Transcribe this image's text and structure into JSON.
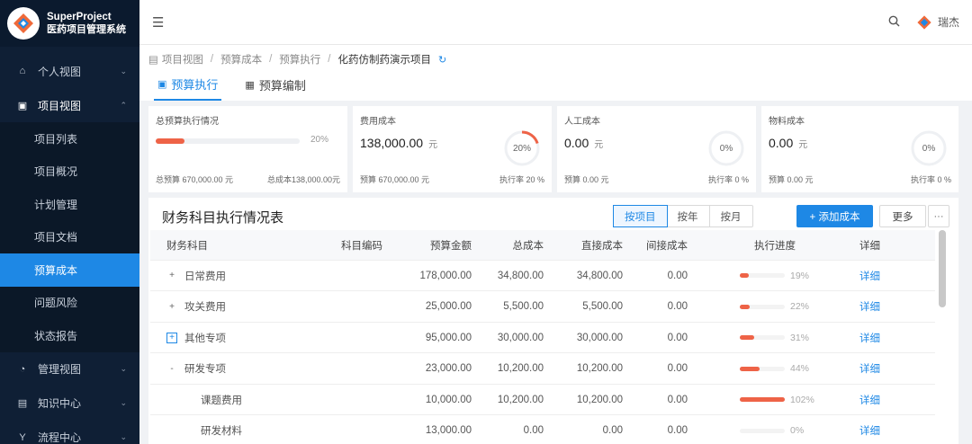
{
  "app": {
    "name_line1": "SuperProject",
    "name_line2": "医药项目管理系统"
  },
  "sidebar": {
    "groups": [
      {
        "label": "个人视图",
        "icon": "home-icon"
      },
      {
        "label": "项目视图",
        "icon": "project-icon"
      }
    ],
    "sub_items": [
      {
        "label": "项目列表"
      },
      {
        "label": "项目概况"
      },
      {
        "label": "计划管理"
      },
      {
        "label": "项目文档"
      },
      {
        "label": "预算成本"
      },
      {
        "label": "问题风险"
      },
      {
        "label": "状态报告"
      }
    ],
    "bottom_groups": [
      {
        "label": "管理视图",
        "icon": "dashboard-icon"
      },
      {
        "label": "知识中心",
        "icon": "book-icon"
      },
      {
        "label": "流程中心",
        "icon": "flow-icon"
      }
    ]
  },
  "topbar": {
    "user": "瑞杰"
  },
  "breadcrumb": {
    "b1": "项目视图",
    "b2": "预算成本",
    "b3": "预算执行",
    "b4": "化药仿制药演示项目"
  },
  "tabs": {
    "t1": "预算执行",
    "t2": "预算编制"
  },
  "cards": {
    "overall": {
      "title": "总预算执行情况",
      "percent": 20,
      "percent_text": "20%",
      "budget": "总预算 670,000.00 元",
      "cost": "总成本138,000.00元"
    },
    "fee": {
      "title": "费用成本",
      "amount": "138,000.00",
      "unit": "元",
      "ring_text": "20%",
      "ring_value": 20,
      "budget": "预算 670,000.00 元",
      "rate": "执行率 20 %"
    },
    "labor": {
      "title": "人工成本",
      "amount": "0.00",
      "unit": "元",
      "ring_text": "0%",
      "ring_value": 0,
      "budget": "预算 0.00 元",
      "rate": "执行率 0 %"
    },
    "material": {
      "title": "物料成本",
      "amount": "0.00",
      "unit": "元",
      "ring_text": "0%",
      "ring_value": 0,
      "budget": "预算 0.00 元",
      "rate": "执行率 0 %"
    }
  },
  "table": {
    "title": "财务科目执行情况表",
    "seg": {
      "s1": "按项目",
      "s2": "按年",
      "s3": "按月"
    },
    "add_label": "+ 添加成本",
    "more_label": "更多",
    "dots_label": "···",
    "headers": {
      "name": "财务科目",
      "code": "科目编码",
      "budget": "预算金额",
      "total": "总成本",
      "direct": "直接成本",
      "indirect": "间接成本",
      "progress": "执行进度",
      "detail": "详细"
    },
    "rows": [
      {
        "expander": "+",
        "name": "日常费用",
        "budget": "178,000.00",
        "total": "34,800.00",
        "direct": "34,800.00",
        "indirect": "0.00",
        "progress": 19,
        "progress_text": "19%",
        "detail": "详细"
      },
      {
        "expander": "+",
        "name": "攻关费用",
        "budget": "25,000.00",
        "total": "5,500.00",
        "direct": "5,500.00",
        "indirect": "0.00",
        "progress": 22,
        "progress_text": "22%",
        "detail": "详细"
      },
      {
        "expander": "+",
        "name": "其他专项",
        "budget": "95,000.00",
        "total": "30,000.00",
        "direct": "30,000.00",
        "indirect": "0.00",
        "progress": 31,
        "progress_text": "31%",
        "detail": "详细"
      },
      {
        "expander": "-",
        "name": "研发专项",
        "budget": "23,000.00",
        "total": "10,200.00",
        "direct": "10,200.00",
        "indirect": "0.00",
        "progress": 44,
        "progress_text": "44%",
        "detail": "详细"
      },
      {
        "expander": "",
        "name": "课题费用",
        "budget": "10,000.00",
        "total": "10,200.00",
        "direct": "10,200.00",
        "indirect": "0.00",
        "progress": 102,
        "progress_text": "102%",
        "detail": "详细"
      },
      {
        "expander": "",
        "name": "研发材料",
        "budget": "13,000.00",
        "total": "0.00",
        "direct": "0.00",
        "indirect": "0.00",
        "progress": 0,
        "progress_text": "0%",
        "detail": "详细"
      }
    ]
  },
  "colors": {
    "accent": "#1e88e5",
    "sidebar": "#0f1f35",
    "progress": "#ee6347"
  }
}
